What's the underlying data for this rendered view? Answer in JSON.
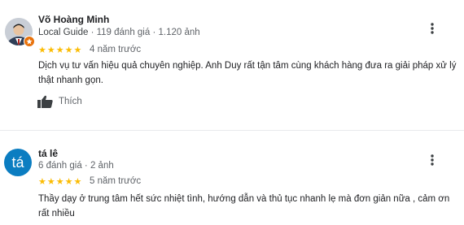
{
  "reviews": [
    {
      "author": "Võ Hoàng Minh",
      "badge": "Local Guide",
      "meta_sep1": " · ",
      "reviews_count": "119 đánh giá",
      "meta_sep2": " · ",
      "photos_count": "1.120 ảnh",
      "rating": 5,
      "time": "4 năm trước",
      "text": "Dịch vụ tư vấn hiệu quả chuyên nghiệp. Anh Duy rất tận tâm cùng khách hàng đưa ra giải pháp xử lý thật nhanh gọn.",
      "like_label": "Thích",
      "avatar_icon": "user-photo-avatar",
      "badge_icon": "local-guide-star-icon",
      "more_icon": "more-vert-icon"
    },
    {
      "author": "tá lê",
      "avatar_letter": "tá",
      "avatar_color": "#0b7dc1",
      "reviews_count": "6 đánh giá",
      "meta_sep": " · ",
      "photos_count": "2 ảnh",
      "rating": 5,
      "time": "5 năm trước",
      "text": "Thầy dạy ở trung tâm hết sức nhiệt tình, hướng dẫn và thủ tục nhanh lẹ mà đơn giản nữa , cảm ơn rất nhiều",
      "more_icon": "more-vert-icon"
    }
  ],
  "colors": {
    "star": "#fbbc04",
    "guide_badge": "#e8710a",
    "muted_text": "#5f6368"
  }
}
